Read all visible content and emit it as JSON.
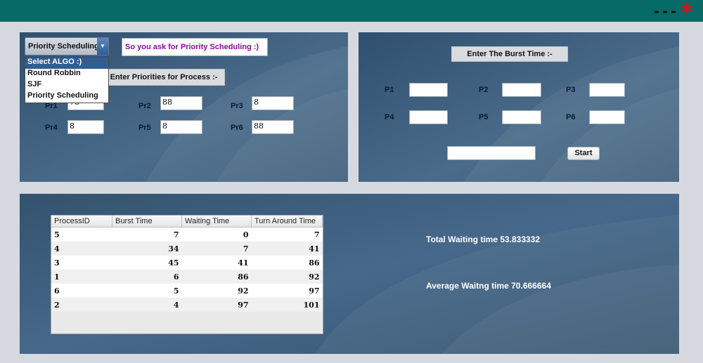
{
  "window": {
    "minimize_label": "---",
    "close_label": "*"
  },
  "algo_panel": {
    "combo_value": "Priority Scheduling",
    "message": "So you ask for Priority Scheduling :)",
    "dropdown_options": [
      "Select ALGO :)",
      "Round Robbin",
      "SJF",
      "Priority Scheduling"
    ],
    "header": "Enter Priorities for Process :-",
    "priorities": [
      {
        "label": "Pr1",
        "value": "78"
      },
      {
        "label": "Pr2",
        "value": "88"
      },
      {
        "label": "Pr3",
        "value": "8"
      },
      {
        "label": "Pr4",
        "value": "8"
      },
      {
        "label": "Pr5",
        "value": "8"
      },
      {
        "label": "Pr6",
        "value": "88"
      }
    ]
  },
  "burst_panel": {
    "header": "Enter The Burst Time :-",
    "processes": [
      {
        "label": "P1",
        "value": ""
      },
      {
        "label": "P2",
        "value": ""
      },
      {
        "label": "P3",
        "value": ""
      },
      {
        "label": "P4",
        "value": ""
      },
      {
        "label": "P5",
        "value": ""
      },
      {
        "label": "P6",
        "value": ""
      }
    ],
    "extra_input": "",
    "start_label": "Start"
  },
  "results": {
    "columns": [
      "ProcessID",
      "Burst Time",
      "Waiting Time",
      "Turn Around Time"
    ],
    "rows": [
      [
        "5",
        "7",
        "0",
        "7"
      ],
      [
        "4",
        "34",
        "7",
        "41"
      ],
      [
        "3",
        "45",
        "41",
        "86"
      ],
      [
        "1",
        "6",
        "86",
        "92"
      ],
      [
        "6",
        "5",
        "92",
        "97"
      ],
      [
        "2",
        "4",
        "97",
        "101"
      ]
    ],
    "total_waiting": "Total Waiting time 53.833332",
    "average_waiting": "Average Waitng time 70.666664"
  }
}
